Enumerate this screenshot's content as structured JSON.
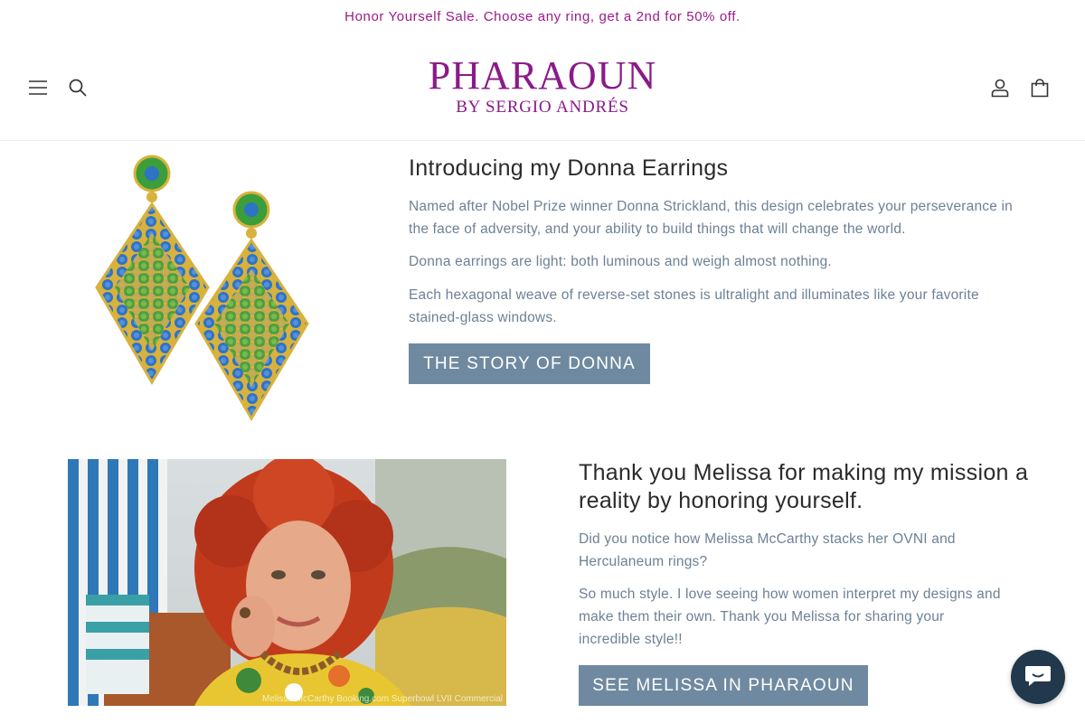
{
  "announcement": {
    "text": "Honor Yourself Sale. Choose any ring, get a 2nd for 50% off."
  },
  "header": {
    "logo_main": "PHARAOUN",
    "logo_sub": "BY SERGIO ANDRÉS",
    "menu_icon": "hamburger-icon",
    "search_icon": "search-icon",
    "account_icon": "account-icon",
    "cart_icon": "cart-icon"
  },
  "section1": {
    "title": "Introducing my Donna Earrings",
    "paragraphs": [
      "Named after Nobel Prize winner Donna Strickland, this design celebrates your perseverance in the face of adversity, and your ability to build things that will change the world.",
      "Donna earrings are light: both luminous and weigh almost nothing.",
      "Each hexagonal weave of reverse-set stones is ultralight and illuminates like your favorite stained-glass windows."
    ],
    "button": "THE STORY OF DONNA"
  },
  "section2": {
    "title": "Thank you Melissa for making my mission a reality by honoring yourself.",
    "paragraphs": [
      "Did you notice how Melissa McCarthy stacks her OVNI and Herculaneum rings?",
      "So much style.  I love seeing how women interpret my designs and make them their own.  Thank you Melissa for sharing your incredible style!!"
    ],
    "button": "SEE MELISSA IN PHARAOUN",
    "photo_caption": "Melissa McCarthy Booking.com Superbowl LVII Commercial"
  },
  "chat": {
    "icon": "chat-icon"
  },
  "colors": {
    "accent": "#9b1a8c",
    "button": "#6f8aa0",
    "body_text": "#6d8196",
    "chat": "#22384c"
  }
}
